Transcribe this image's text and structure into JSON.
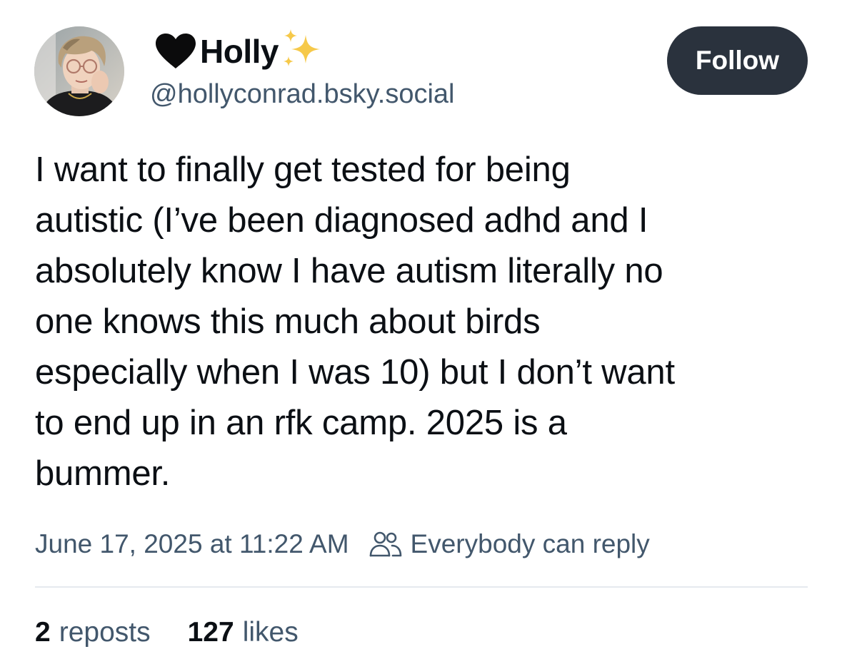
{
  "author": {
    "display_name": "Holly",
    "handle": "@hollyconrad.bsky.social",
    "name_prefix_icon": "black-heart-icon",
    "name_suffix_icon": "sparkles-icon",
    "avatar": "profile-photo"
  },
  "follow_button": {
    "label": "Follow"
  },
  "post": {
    "text": "I want to finally get tested for being\nautistic (I’ve been diagnosed adhd and I\nabsolutely know I have autism literally no\none knows this much about birds\nespecially when I was 10) but I don’t want\nto end up in an rfk camp. 2025 is a\nbummer.",
    "timestamp": "June 17, 2025 at 11:22 AM",
    "reply_setting": "Everybody can reply",
    "reply_setting_icon": "people-icon"
  },
  "stats": {
    "reposts_count": "2",
    "reposts_label": "reposts",
    "likes_count": "127",
    "likes_label": "likes"
  },
  "colors": {
    "text_primary": "#0b0f14",
    "text_secondary": "#42576c",
    "follow_button_bg": "#2a323d",
    "divider": "#e5e9ee",
    "sparkle": "#f5c518"
  }
}
